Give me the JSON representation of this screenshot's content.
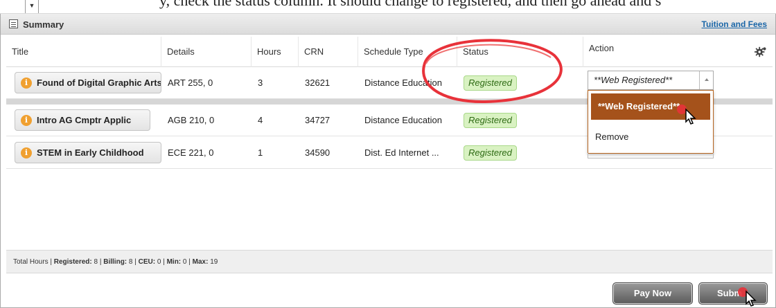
{
  "top_strip": {
    "cut_text": "y, check the status column. It should change to registered, and then go ahead and s"
  },
  "panel": {
    "title": "Summary",
    "link": "Tuition and Fees"
  },
  "table": {
    "headers": [
      "Title",
      "Details",
      "Hours",
      "CRN",
      "Schedule Type",
      "Status",
      "Action"
    ],
    "rows": [
      {
        "title": "Found of Digital Graphic Arts",
        "details": "ART 255, 0",
        "hours": "3",
        "crn": "32621",
        "schedule": "Distance Education",
        "status": "Registered"
      },
      {
        "title": "Intro AG Cmptr Applic",
        "details": "AGB 210, 0",
        "hours": "4",
        "crn": "34727",
        "schedule": "Distance Education",
        "status": "Registered"
      },
      {
        "title": "STEM in Early Childhood",
        "details": "ECE 221, 0",
        "hours": "1",
        "crn": "34590",
        "schedule": "Dist. Ed Internet ...",
        "status": "Registered"
      }
    ]
  },
  "action_dropdown": {
    "selected": "**Web Registered**",
    "options": [
      "**Web Registered**",
      "Remove"
    ]
  },
  "totals": {
    "prefix": "Total Hours | ",
    "registered_label": "Registered:",
    "registered": "8",
    "billing_label": "Billing:",
    "billing": "8",
    "ceu_label": "CEU:",
    "ceu": "0",
    "min_label": "Min:",
    "min": "0",
    "max_label": "Max:",
    "max": "19"
  },
  "buttons": {
    "pay_now": "Pay Now",
    "submit": "Subm"
  },
  "colors": {
    "status_bg": "#d9f2c2",
    "status_text": "#2e6b14",
    "menu_selected": "#a5521b",
    "link": "#1a66a8",
    "annotation": "#e8323a"
  },
  "icons": [
    "summary-icon",
    "info-icon",
    "gear-icon",
    "chevron-up-icon",
    "cursor-pointer-icon"
  ]
}
